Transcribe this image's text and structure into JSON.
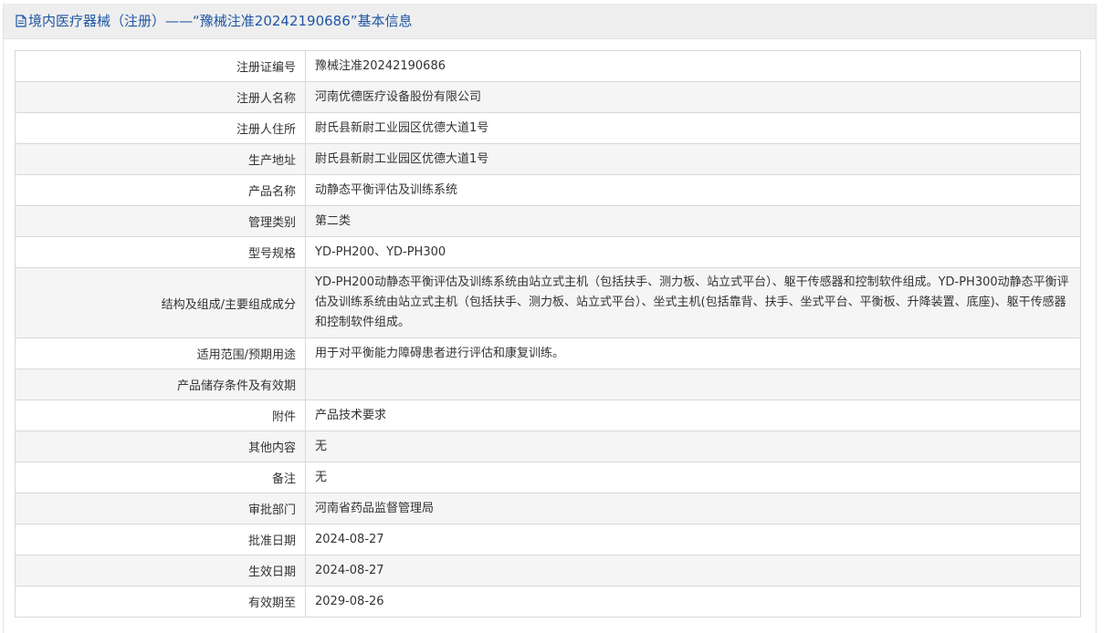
{
  "header": {
    "title": "境内医疗器械（注册）——“豫械注准20242190686”基本信息",
    "icon": "document-icon"
  },
  "rows": [
    {
      "label": "注册证编号",
      "value": "豫械注准20242190686"
    },
    {
      "label": "注册人名称",
      "value": "河南优德医疗设备股份有限公司"
    },
    {
      "label": "注册人住所",
      "value": "尉氏县新尉工业园区优德大道1号"
    },
    {
      "label": "生产地址",
      "value": "尉氏县新尉工业园区优德大道1号"
    },
    {
      "label": "产品名称",
      "value": "动静态平衡评估及训练系统"
    },
    {
      "label": "管理类别",
      "value": "第二类"
    },
    {
      "label": "型号规格",
      "value": "YD-PH200、YD-PH300"
    },
    {
      "label": "结构及组成/主要组成成分",
      "value": "YD-PH200动静态平衡评估及训练系统由站立式主机（包括扶手、测力板、站立式平台）、躯干传感器和控制软件组成。YD-PH300动静态平衡评估及训练系统由站立式主机（包括扶手、测力板、站立式平台）、坐式主机(包括靠背、扶手、坐式平台、平衡板、升降装置、底座)、躯干传感器和控制软件组成。"
    },
    {
      "label": "适用范围/预期用途",
      "value": "用于对平衡能力障碍患者进行评估和康复训练。"
    },
    {
      "label": "产品储存条件及有效期",
      "value": ""
    },
    {
      "label": "附件",
      "value": "产品技术要求"
    },
    {
      "label": "其他内容",
      "value": "无"
    },
    {
      "label": "备注",
      "value": "无"
    },
    {
      "label": "审批部门",
      "value": "河南省药品监督管理局"
    },
    {
      "label": "批准日期",
      "value": "2024-08-27"
    },
    {
      "label": "生效日期",
      "value": "2024-08-27"
    },
    {
      "label": "有效期至",
      "value": "2029-08-26"
    }
  ],
  "colors": {
    "title": "#1f56a3",
    "border": "#d8d8d8",
    "stripe": "#f5f5f5"
  }
}
